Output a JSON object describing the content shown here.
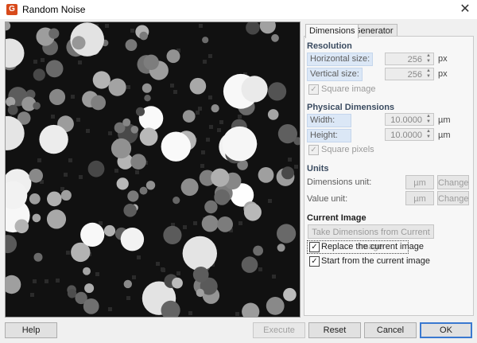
{
  "window": {
    "title": "Random Noise",
    "app_icon": "gwyddion-app-icon",
    "close_glyph": "✕"
  },
  "tabs": [
    {
      "label": "Dimensions",
      "active": true
    },
    {
      "label": "Generator",
      "active": false
    }
  ],
  "dimensions": {
    "resolution": {
      "heading": "Resolution",
      "horizontal": {
        "label": "Horizontal size:",
        "value": "256",
        "unit": "px"
      },
      "vertical": {
        "label": "Vertical size:",
        "value": "256",
        "unit": "px"
      },
      "square_image": {
        "label": "Square image",
        "checked": true,
        "enabled": false
      }
    },
    "physical": {
      "heading": "Physical Dimensions",
      "width": {
        "label": "Width:",
        "value": "10.0000",
        "unit": "µm"
      },
      "height": {
        "label": "Height:",
        "value": "10.0000",
        "unit": "µm"
      },
      "square_pixels": {
        "label": "Square pixels",
        "checked": true,
        "enabled": false
      }
    },
    "units": {
      "heading": "Units",
      "dimensions_unit": {
        "label": "Dimensions unit:",
        "value": "µm",
        "change_label": "Change"
      },
      "value_unit": {
        "label": "Value unit:",
        "value": "µm",
        "change_label": "Change"
      }
    },
    "current_image": {
      "heading": "Current Image",
      "take_dimensions_label": "Take Dimensions from Current Image",
      "replace": {
        "label": "Replace the current image",
        "checked": true
      },
      "start_from": {
        "label": "Start from the current image",
        "checked": true
      }
    }
  },
  "buttons": {
    "help": "Help",
    "execute": "Execute",
    "reset": "Reset",
    "cancel": "Cancel",
    "ok": "OK"
  },
  "preview": {
    "background": "#111111",
    "description_icon": "noise-preview"
  }
}
